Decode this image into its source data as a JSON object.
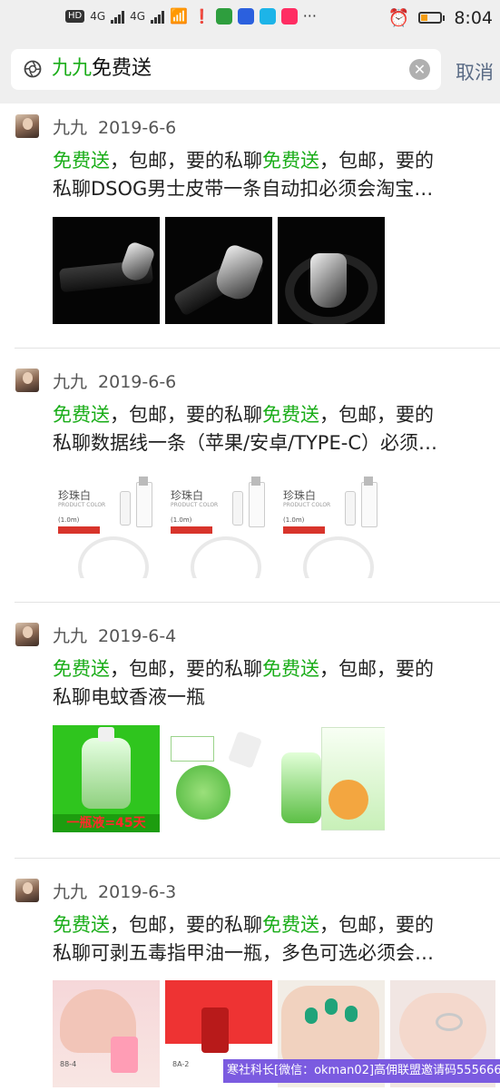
{
  "status_bar": {
    "hd_label": "HD",
    "sim1": "4G",
    "sim2": "4G",
    "time": "8:04",
    "more": "···"
  },
  "search": {
    "query_highlight": "九九",
    "query_rest": "免费送",
    "clear_icon": "close-circle-icon",
    "cancel_label": "取消"
  },
  "posts": [
    {
      "name": "九九",
      "date": "2019-6-6",
      "line1": [
        "免费送",
        "，包邮，要的私聊",
        "免费送",
        "，包邮，要的"
      ],
      "line2": "私聊DSOG男士皮带一条自动扣必须会淘宝…"
    },
    {
      "name": "九九",
      "date": "2019-6-6",
      "line1": [
        "免费送",
        "，包邮，要的私聊",
        "免费送",
        "，包邮，要的"
      ],
      "line2": "私聊数据线一条（苹果/安卓/TYPE-C）必须…",
      "cable_title": "珍珠白",
      "cable_sub": "PRODUCT COLOR",
      "cable_len": "(1.0m)"
    },
    {
      "name": "九九",
      "date": "2019-6-4",
      "line1": [
        "免费送",
        "，包邮，要的私聊",
        "免费送",
        "，包邮，要的"
      ],
      "line2": "私聊电蚊香液一瓶",
      "banner": "一瓶液=45天"
    },
    {
      "name": "九九",
      "date": "2019-6-3",
      "line1": [
        "免费送",
        "，包邮，要的私聊",
        "免费送",
        "，包邮，要的"
      ],
      "line2": "私聊可剥五毒指甲油一瓶，多色可选必须会…",
      "nail_label_1": "88-4",
      "nail_label_2": "8A-2"
    }
  ],
  "watermark": "寒社科长[微信：okman02]高佣联盟邀请码555666",
  "colors": {
    "highlight": "#1aad19",
    "cancel": "#5a6b85",
    "header_bg": "#efefef"
  }
}
